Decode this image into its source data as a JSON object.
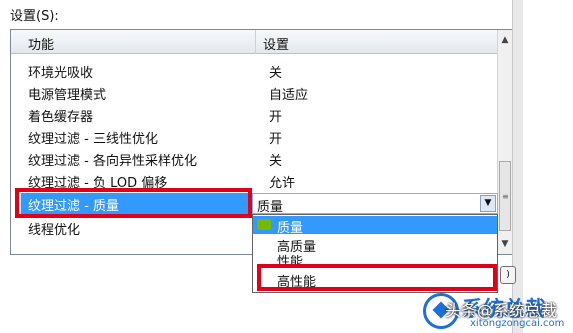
{
  "settings_label": "设置(S):",
  "table": {
    "headers": {
      "feature": "功能",
      "setting": "设置"
    },
    "rows": [
      {
        "feature": "环境光吸收",
        "value": "关"
      },
      {
        "feature": "电源管理模式",
        "value": "自适应"
      },
      {
        "feature": "着色缓存器",
        "value": "开"
      },
      {
        "feature": "纹理过滤 - 三线性优化",
        "value": "开"
      },
      {
        "feature": "纹理过滤 - 各向异性采样优化",
        "value": "关"
      },
      {
        "feature": "纹理过滤 - 负 LOD 偏移",
        "value": "允许"
      },
      {
        "feature": "纹理过滤 - 质量",
        "value": ""
      },
      {
        "feature": "线程优化",
        "value": ""
      }
    ],
    "selected_index": 6
  },
  "combo": {
    "value": "质量"
  },
  "dropdown": {
    "options": [
      "质量",
      "高质量",
      "性能",
      "高性能"
    ],
    "selected": "质量"
  },
  "watermark": {
    "title": "系统总裁",
    "url": "xitongzongcai.com",
    "overlay": "头条@系统总裁"
  },
  "colors": {
    "highlight": "#3399ff",
    "red_box": "#e0001a",
    "nvidia_green": "#76b900"
  }
}
